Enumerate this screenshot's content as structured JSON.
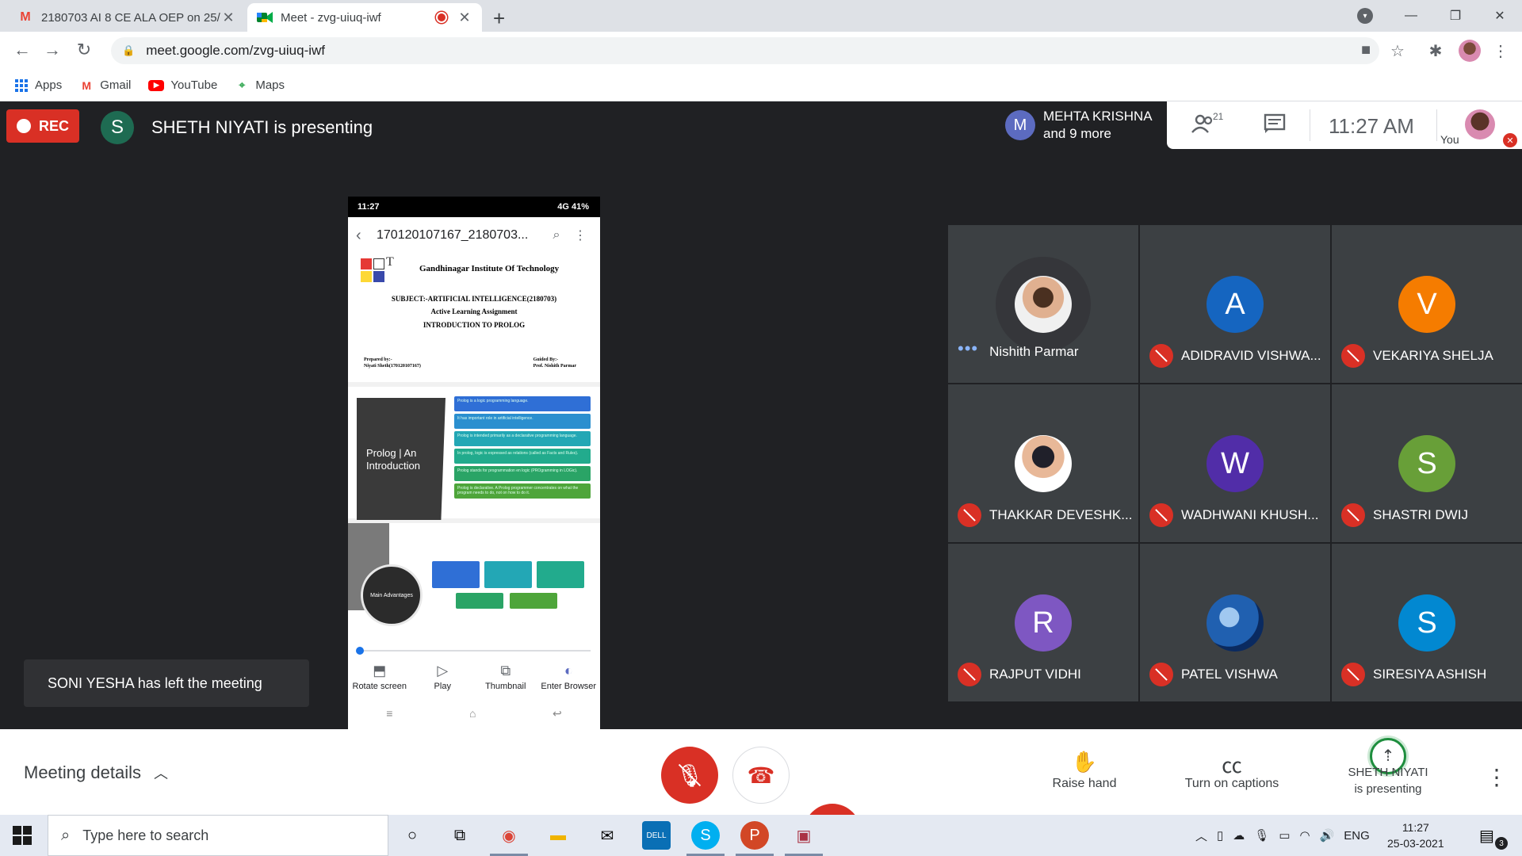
{
  "browser": {
    "tabs": [
      {
        "title": "2180703 AI 8 CE ALA OEP on 25/",
        "icon": "gmail-icon",
        "active": false
      },
      {
        "title": "Meet - zvg-uiuq-iwf",
        "icon": "meet-icon",
        "active": true
      }
    ],
    "url": "meet.google.com/zvg-uiuq-iwf",
    "bookmarks": [
      {
        "label": "Apps",
        "icon": "apps-grid-icon"
      },
      {
        "label": "Gmail",
        "icon": "gmail-icon"
      },
      {
        "label": "YouTube",
        "icon": "youtube-icon"
      },
      {
        "label": "Maps",
        "icon": "maps-icon"
      }
    ]
  },
  "meet": {
    "rec_label": "REC",
    "presenter_initial": "S",
    "presenter_text": "SHETH NIYATI is presenting",
    "people_initial": "M",
    "people_line1": "MEHTA KRISHNA",
    "people_line2": "and 9 more",
    "participant_count": "21",
    "time": "11:27  AM",
    "you_label": "You",
    "toast": "SONI YESHA has left the meeting"
  },
  "presentation": {
    "status_left": "11:27",
    "status_right": "4G 41%",
    "file_name": "170120107167_2180703...",
    "slide1": {
      "institute": "Gandhinagar Institute Of  Technology",
      "subject": "SUBJECT:-ARTIFICIAL INTELLIGENCE(2180703)",
      "assignment": "Active Learning Assignment",
      "topic": "INTRODUCTION TO PROLOG",
      "prepared_label": "Prepared by:-",
      "prepared_name": "Niyati Sheth(170120107167)",
      "guided_label": "Guided By:-",
      "guided_name": "Prof. Nishith Parmar"
    },
    "slide2": {
      "title": "Prolog | An Introduction",
      "bullets": [
        "Prolog is a logic programming language.",
        "It has important role in artificial intelligence.",
        "Prolog is intended primarily as a declarative programming language.",
        "In prolog, logic is expressed as relations (called as Facts and Rules).",
        "Prolog stands for programmation en logic (PROgramming in LOGic).",
        "Prolog is declarative. A Prolog programmer concentrates on what the program needs to do, not on how to do it."
      ]
    },
    "slide3": {
      "title": "Main Advantages"
    },
    "actions": [
      {
        "label": "Rotate screen",
        "icon": "rotate-icon"
      },
      {
        "label": "Play",
        "icon": "play-icon"
      },
      {
        "label": "Thumbnail",
        "icon": "thumbnail-icon"
      },
      {
        "label": "Enter Browser",
        "icon": "browser-icon"
      }
    ]
  },
  "participants": [
    {
      "name": "Nishith Parmar",
      "initial": "",
      "color": "",
      "muted": false
    },
    {
      "name": "ADIDRAVID VISHWA...",
      "initial": "A",
      "color": "#1565c0",
      "muted": true
    },
    {
      "name": "VEKARIYA SHELJA",
      "initial": "V",
      "color": "#f57c00",
      "muted": true
    },
    {
      "name": "THAKKAR DEVESHK...",
      "initial": "",
      "color": "",
      "muted": true
    },
    {
      "name": "WADHWANI KHUSH...",
      "initial": "W",
      "color": "#512da8",
      "muted": true
    },
    {
      "name": "SHASTRI DWIJ",
      "initial": "S",
      "color": "#689f38",
      "muted": true
    },
    {
      "name": "RAJPUT VIDHI",
      "initial": "R",
      "color": "#7e57c2",
      "muted": true
    },
    {
      "name": "PATEL VISHWA",
      "initial": "",
      "color": "",
      "muted": true
    },
    {
      "name": "SIRESIYA ASHISH",
      "initial": "S",
      "color": "#0288d1",
      "muted": true
    }
  ],
  "controls": {
    "meeting_details": "Meeting details",
    "raise_hand": "Raise hand",
    "captions": "Turn on captions",
    "presenting_line1": "SHETH NIYATI",
    "presenting_line2": "is presenting"
  },
  "taskbar": {
    "search_placeholder": "Type here to search",
    "lang": "ENG",
    "time": "11:27",
    "date": "25-03-2021",
    "notif_count": "3"
  }
}
